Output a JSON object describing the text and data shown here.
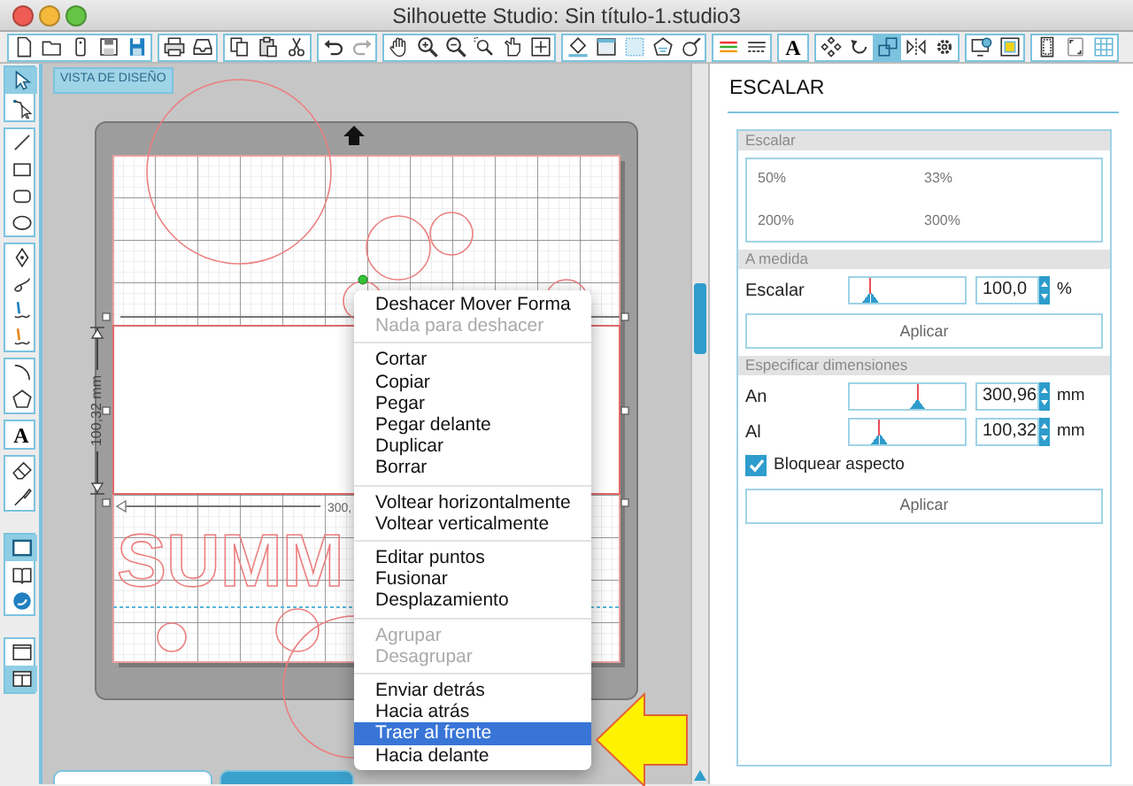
{
  "window": {
    "title": "Silhouette Studio: Sin título-1.studio3"
  },
  "toolbar": [
    [
      {
        "kind": "new",
        "selected": false
      },
      {
        "kind": "open",
        "selected": false
      },
      {
        "kind": "device",
        "selected": false
      },
      {
        "kind": "save",
        "selected": false
      },
      {
        "kind": "save_library",
        "selected": false
      }
    ],
    [
      {
        "kind": "print",
        "selected": false
      },
      {
        "kind": "send",
        "selected": false
      }
    ],
    [
      {
        "kind": "copy",
        "selected": false
      },
      {
        "kind": "paste",
        "selected": false
      },
      {
        "kind": "cut",
        "selected": false
      }
    ],
    [
      {
        "kind": "undo",
        "selected": false
      },
      {
        "kind": "redo",
        "selected": false
      }
    ],
    [
      {
        "kind": "pan",
        "selected": false
      },
      {
        "kind": "zoom_in",
        "selected": false
      },
      {
        "kind": "zoom_out",
        "selected": false
      },
      {
        "kind": "zoom_box",
        "selected": false
      },
      {
        "kind": "zoom_drag",
        "selected": false
      },
      {
        "kind": "fit",
        "selected": false
      }
    ],
    [
      {
        "kind": "fill",
        "selected": false
      },
      {
        "kind": "line_style",
        "selected": false
      },
      {
        "kind": "pattern",
        "selected": false
      },
      {
        "kind": "shadow",
        "selected": false
      },
      {
        "kind": "knife",
        "selected": false
      }
    ],
    [
      {
        "kind": "color_lines",
        "selected": false
      },
      {
        "kind": "line_types",
        "selected": false
      }
    ],
    [
      {
        "kind": "text",
        "label": "A",
        "selected": false
      }
    ],
    [
      {
        "kind": "replicate",
        "selected": false
      },
      {
        "kind": "rotate",
        "selected": false
      },
      {
        "kind": "scale",
        "selected": true
      },
      {
        "kind": "mirror",
        "selected": false
      },
      {
        "kind": "transform",
        "selected": false
      }
    ],
    [
      {
        "kind": "library",
        "selected": false
      },
      {
        "kind": "cut_settings",
        "selected": false
      }
    ],
    [
      {
        "kind": "page",
        "selected": false
      },
      {
        "kind": "registration",
        "selected": false
      },
      {
        "kind": "grid",
        "selected": false
      }
    ]
  ],
  "tools": [
    [
      {
        "kind": "select",
        "selected": true
      },
      {
        "kind": "point_edit",
        "selected": false
      }
    ],
    [
      {
        "kind": "line",
        "selected": false
      },
      {
        "kind": "rect",
        "selected": false
      },
      {
        "kind": "rounded_rect",
        "selected": false
      },
      {
        "kind": "ellipse",
        "selected": false
      }
    ],
    [
      {
        "kind": "bezier",
        "selected": false
      },
      {
        "kind": "curve",
        "selected": false
      },
      {
        "kind": "pencil",
        "selected": false
      },
      {
        "kind": "pencil_alt",
        "selected": false
      }
    ],
    [
      {
        "kind": "arc",
        "selected": false
      },
      {
        "kind": "polygon",
        "selected": false
      }
    ],
    [
      {
        "kind": "text",
        "label": "A",
        "selected": false
      }
    ],
    [
      {
        "kind": "eraser",
        "selected": false
      },
      {
        "kind": "knife_tool",
        "selected": false
      }
    ],
    [
      {
        "kind": "design_view",
        "selected": true
      },
      {
        "kind": "library_view",
        "selected": false
      },
      {
        "kind": "store_view",
        "selected": false
      }
    ],
    [
      {
        "kind": "single_window",
        "selected": false
      },
      {
        "kind": "split_view",
        "selected": true
      }
    ]
  ],
  "canvas": {
    "view_label": "VISTA DE DISEÑO",
    "height_label": "100,32 mm",
    "width_label": "300,",
    "design_text": "SUMM"
  },
  "context_menu": {
    "sections": [
      {
        "items": [
          {
            "label": "Deshacer Mover Forma",
            "disabled": false,
            "selected": false
          },
          {
            "label": "Nada para deshacer",
            "disabled": true,
            "selected": false
          }
        ]
      },
      {
        "items": [
          {
            "label": "Cortar",
            "disabled": false,
            "selected": false
          },
          {
            "label": "Copiar",
            "disabled": false,
            "selected": false
          },
          {
            "label": "Pegar",
            "disabled": false,
            "selected": false
          },
          {
            "label": "Pegar delante",
            "disabled": false,
            "selected": false
          },
          {
            "label": "Duplicar",
            "disabled": false,
            "selected": false
          },
          {
            "label": "Borrar",
            "disabled": false,
            "selected": false
          }
        ]
      },
      {
        "items": [
          {
            "label": "Voltear horizontalmente",
            "disabled": false,
            "selected": false
          },
          {
            "label": "Voltear verticalmente",
            "disabled": false,
            "selected": false
          }
        ]
      },
      {
        "items": [
          {
            "label": "Editar puntos",
            "disabled": false,
            "selected": false
          },
          {
            "label": "Fusionar",
            "disabled": false,
            "selected": false
          },
          {
            "label": "Desplazamiento",
            "disabled": false,
            "selected": false
          }
        ]
      },
      {
        "items": [
          {
            "label": "Agrupar",
            "disabled": true,
            "selected": false
          },
          {
            "label": "Desagrupar",
            "disabled": true,
            "selected": false
          }
        ]
      },
      {
        "items": [
          {
            "label": "Enviar detrás",
            "disabled": false,
            "selected": false
          },
          {
            "label": "Hacia atrás",
            "disabled": false,
            "selected": false
          },
          {
            "label": "Traer al frente",
            "disabled": false,
            "selected": true
          },
          {
            "label": "Hacia delante",
            "disabled": false,
            "selected": false
          }
        ]
      }
    ]
  },
  "document_tabs": [
    {
      "selected": false
    },
    {
      "selected": true
    }
  ],
  "panel": {
    "title": "ESCALAR",
    "preset_section": {
      "heading": "Escalar",
      "presets": [
        "50%",
        "33%",
        "200%",
        "300%"
      ]
    },
    "custom_section": {
      "heading": "A medida",
      "rows": [
        {
          "label": "Escalar",
          "level": 0.13,
          "value": "100,0",
          "unit": "%"
        }
      ],
      "button": "Aplicar"
    },
    "dimensions_section": {
      "heading": "Especificar dimensiones",
      "rows": [
        {
          "label": "An",
          "level": 0.6,
          "value": "300,96",
          "unit": "mm"
        },
        {
          "label": "Al",
          "level": 0.22,
          "value": "100,32",
          "unit": "mm"
        }
      ],
      "lock": {
        "label": "Bloquear aspecto",
        "checked": true
      },
      "button": "Aplicar"
    }
  }
}
